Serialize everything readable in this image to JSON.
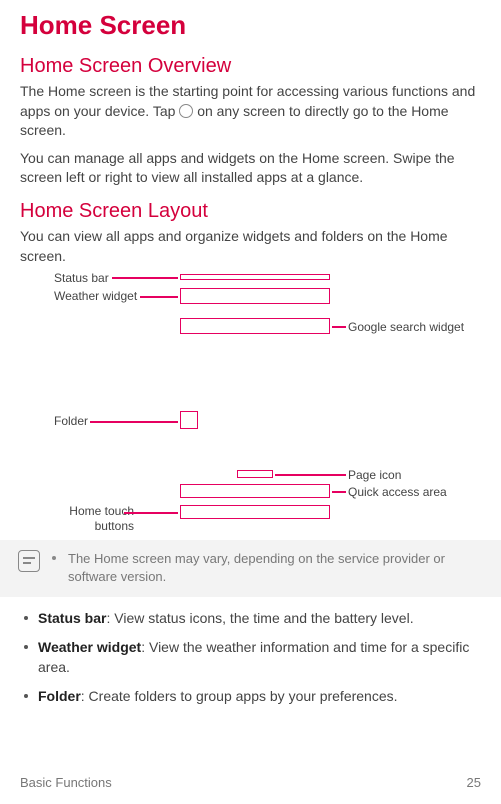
{
  "h1": "Home Screen",
  "section1": {
    "title": "Home Screen Overview",
    "p1a": "The Home screen is the starting point for accessing various functions and apps on your device. Tap ",
    "p1b": " on any screen to directly go to the Home screen.",
    "p2": "You can manage all apps and widgets on the Home screen. Swipe the screen left or right to view all installed apps at a glance."
  },
  "section2": {
    "title": "Home Screen Layout",
    "p1": "You can view all apps and organize widgets and folders on the Home screen.",
    "labels": {
      "status_bar": "Status bar",
      "weather_widget": "Weather widget",
      "google_search": "Google search widget",
      "folder": "Folder",
      "page_icon": "Page icon",
      "quick_access": "Quick access area",
      "home_touch": "Home touch buttons"
    }
  },
  "note": "The Home screen may vary, depending on the service provider or software version.",
  "bullets": [
    {
      "term": "Status bar",
      "desc": ": View status icons, the time and the battery level."
    },
    {
      "term": "Weather widget",
      "desc": ": View the weather information and time for a specific area."
    },
    {
      "term": "Folder",
      "desc": ": Create folders to group apps by your preferences."
    }
  ],
  "footer": {
    "left": "Basic Functions",
    "right": "25"
  }
}
